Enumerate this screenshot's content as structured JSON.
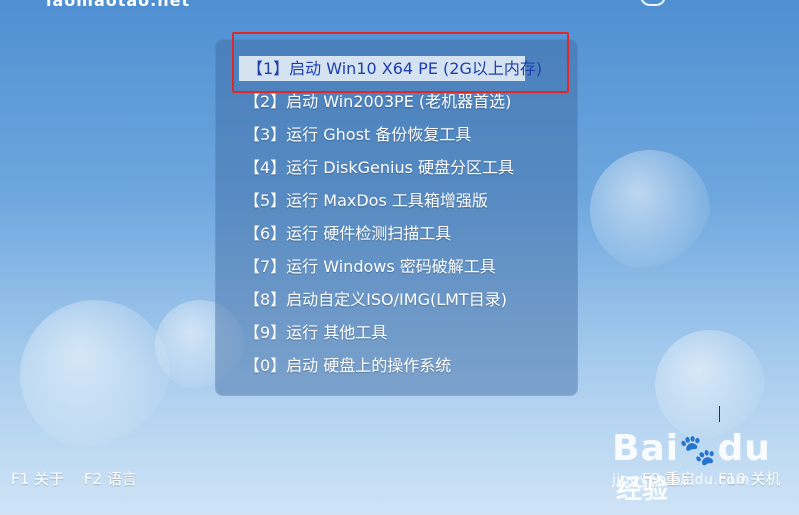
{
  "brand": "laomaotao.net",
  "menu": {
    "items": [
      "【1】启动 Win10 X64 PE (2G以上内存)",
      "【2】启动 Win2003PE (老机器首选)",
      "【3】运行 Ghost 备份恢复工具",
      "【4】运行 DiskGenius 硬盘分区工具",
      "【5】运行 MaxDos 工具箱增强版",
      "【6】运行 硬件检测扫描工具",
      "【7】运行 Windows 密码破解工具",
      "【8】启动自定义ISO/IMG(LMT目录)",
      "【9】运行 其他工具",
      "【0】启动 硬盘上的操作系统"
    ],
    "selected_index": 0
  },
  "footer": {
    "f1": "F1 关于",
    "f2": "F2 语言",
    "f9": "F9 重启",
    "f10": "F10 关机"
  },
  "watermark": {
    "logo": "Bai",
    "logo_end": "du",
    "cn": "经验",
    "sub": "jingyan.baidu.com"
  },
  "colors": {
    "highlight_box": "#e0272a",
    "selected_text": "#1f3fb0"
  }
}
